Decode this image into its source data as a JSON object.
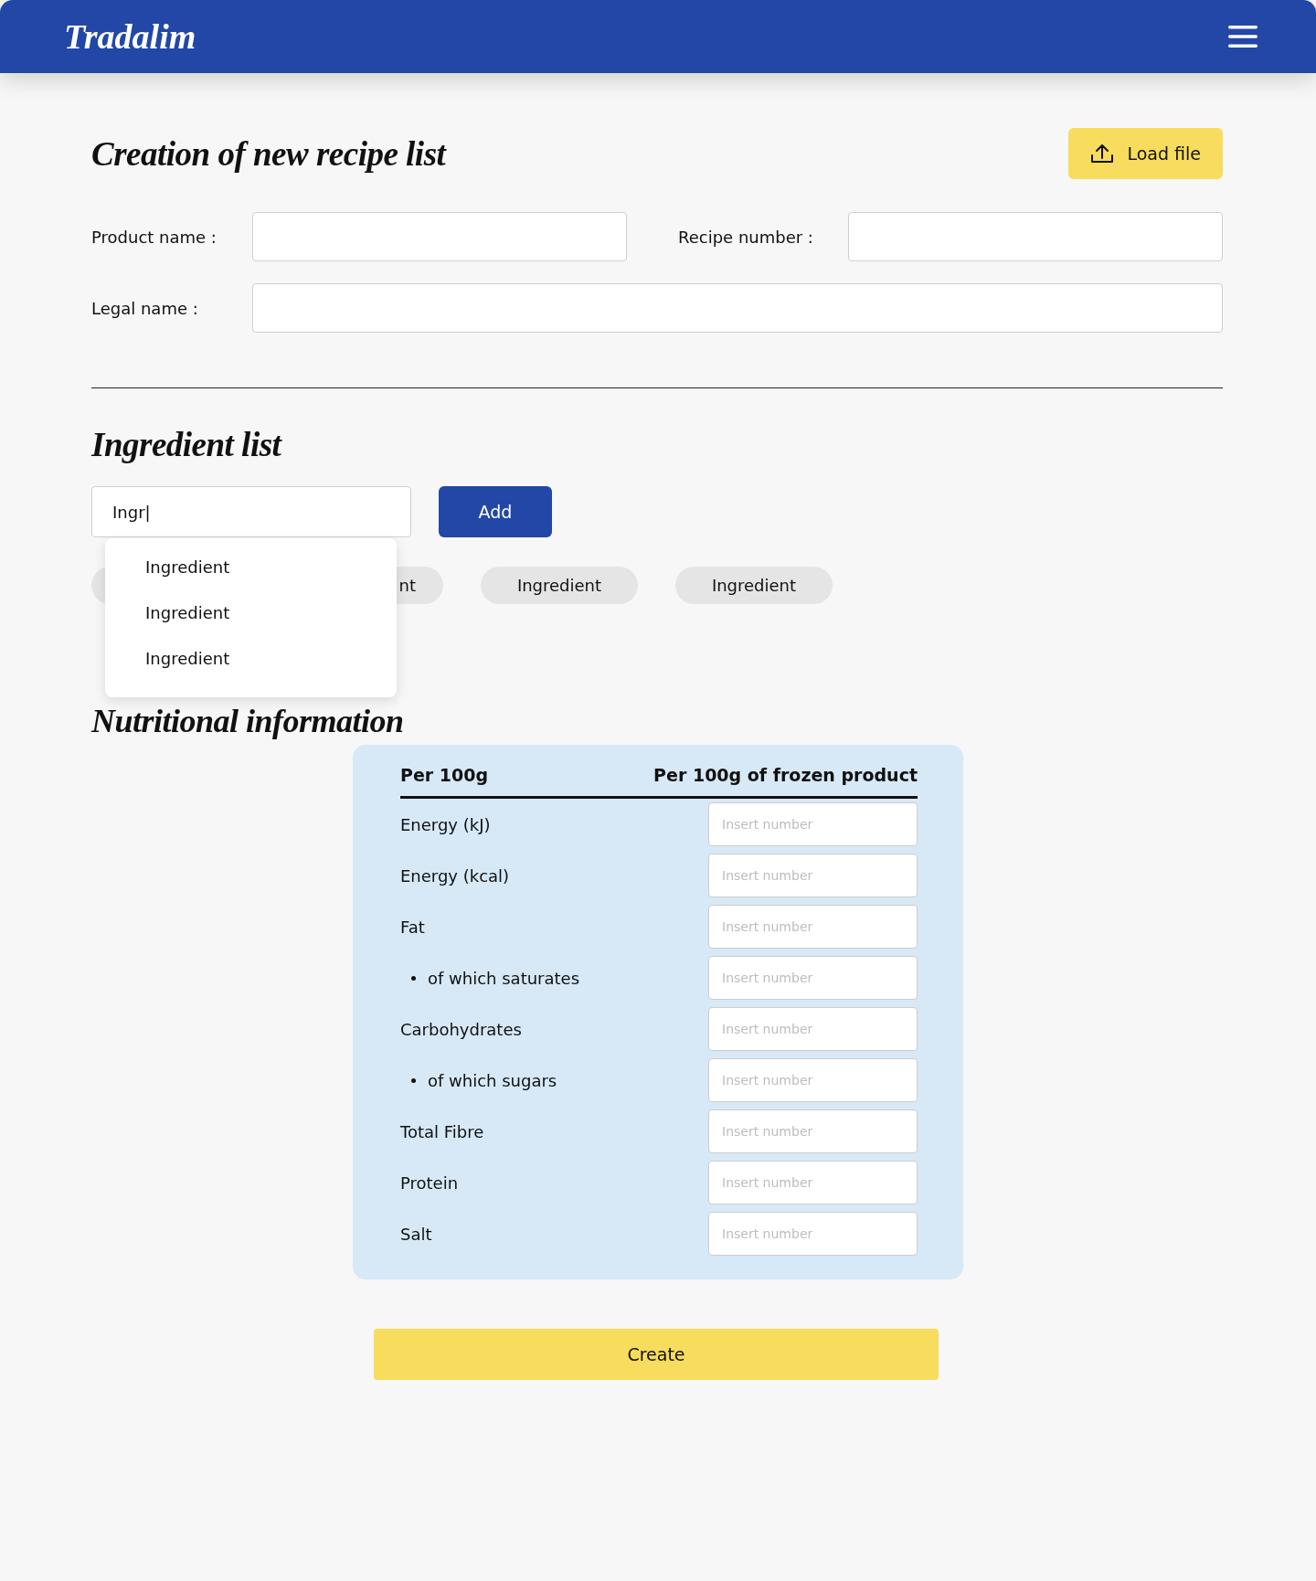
{
  "header": {
    "logo": "Tradalim"
  },
  "recipe": {
    "title": "Creation of new recipe list",
    "load_button": "Load file",
    "fields": [
      {
        "label": "Product name :"
      },
      {
        "label": "Recipe number :"
      },
      {
        "label": "Legal name :"
      }
    ]
  },
  "ingredients": {
    "title": "Ingredient list",
    "search_value": "Ingr|",
    "add_button": "Add",
    "chips": [
      {
        "kind": "covered"
      },
      {
        "kind": "covered",
        "label": "nt"
      },
      {
        "kind": "plain",
        "label": "Ingredient"
      },
      {
        "kind": "plain",
        "label": "Ingredient"
      }
    ],
    "suggestions": [
      "Ingredient",
      "Ingredient",
      "Ingredient"
    ]
  },
  "nutrition": {
    "title": "Nutritional information",
    "columns": [
      "Per 100g",
      "Per 100g of frozen product"
    ],
    "rows": [
      {
        "label": "Energy (kJ)",
        "kind": "main",
        "placeholder": "Insert number"
      },
      {
        "label": "Energy (kcal)",
        "kind": "main",
        "placeholder": "Insert number"
      },
      {
        "label": "Fat",
        "kind": "main",
        "placeholder": "Insert number"
      },
      {
        "label": "of which saturates",
        "kind": "sub",
        "placeholder": "Insert number"
      },
      {
        "label": "Carbohydrates",
        "kind": "main",
        "placeholder": "Insert number"
      },
      {
        "label": "of which sugars",
        "kind": "sub",
        "placeholder": "Insert number"
      },
      {
        "label": "Total Fibre",
        "kind": "main",
        "placeholder": "Insert number"
      },
      {
        "label": "Protein",
        "kind": "main",
        "placeholder": "Insert number"
      },
      {
        "label": "Salt",
        "kind": "main",
        "placeholder": "Insert number"
      }
    ]
  },
  "create_button": "Create"
}
